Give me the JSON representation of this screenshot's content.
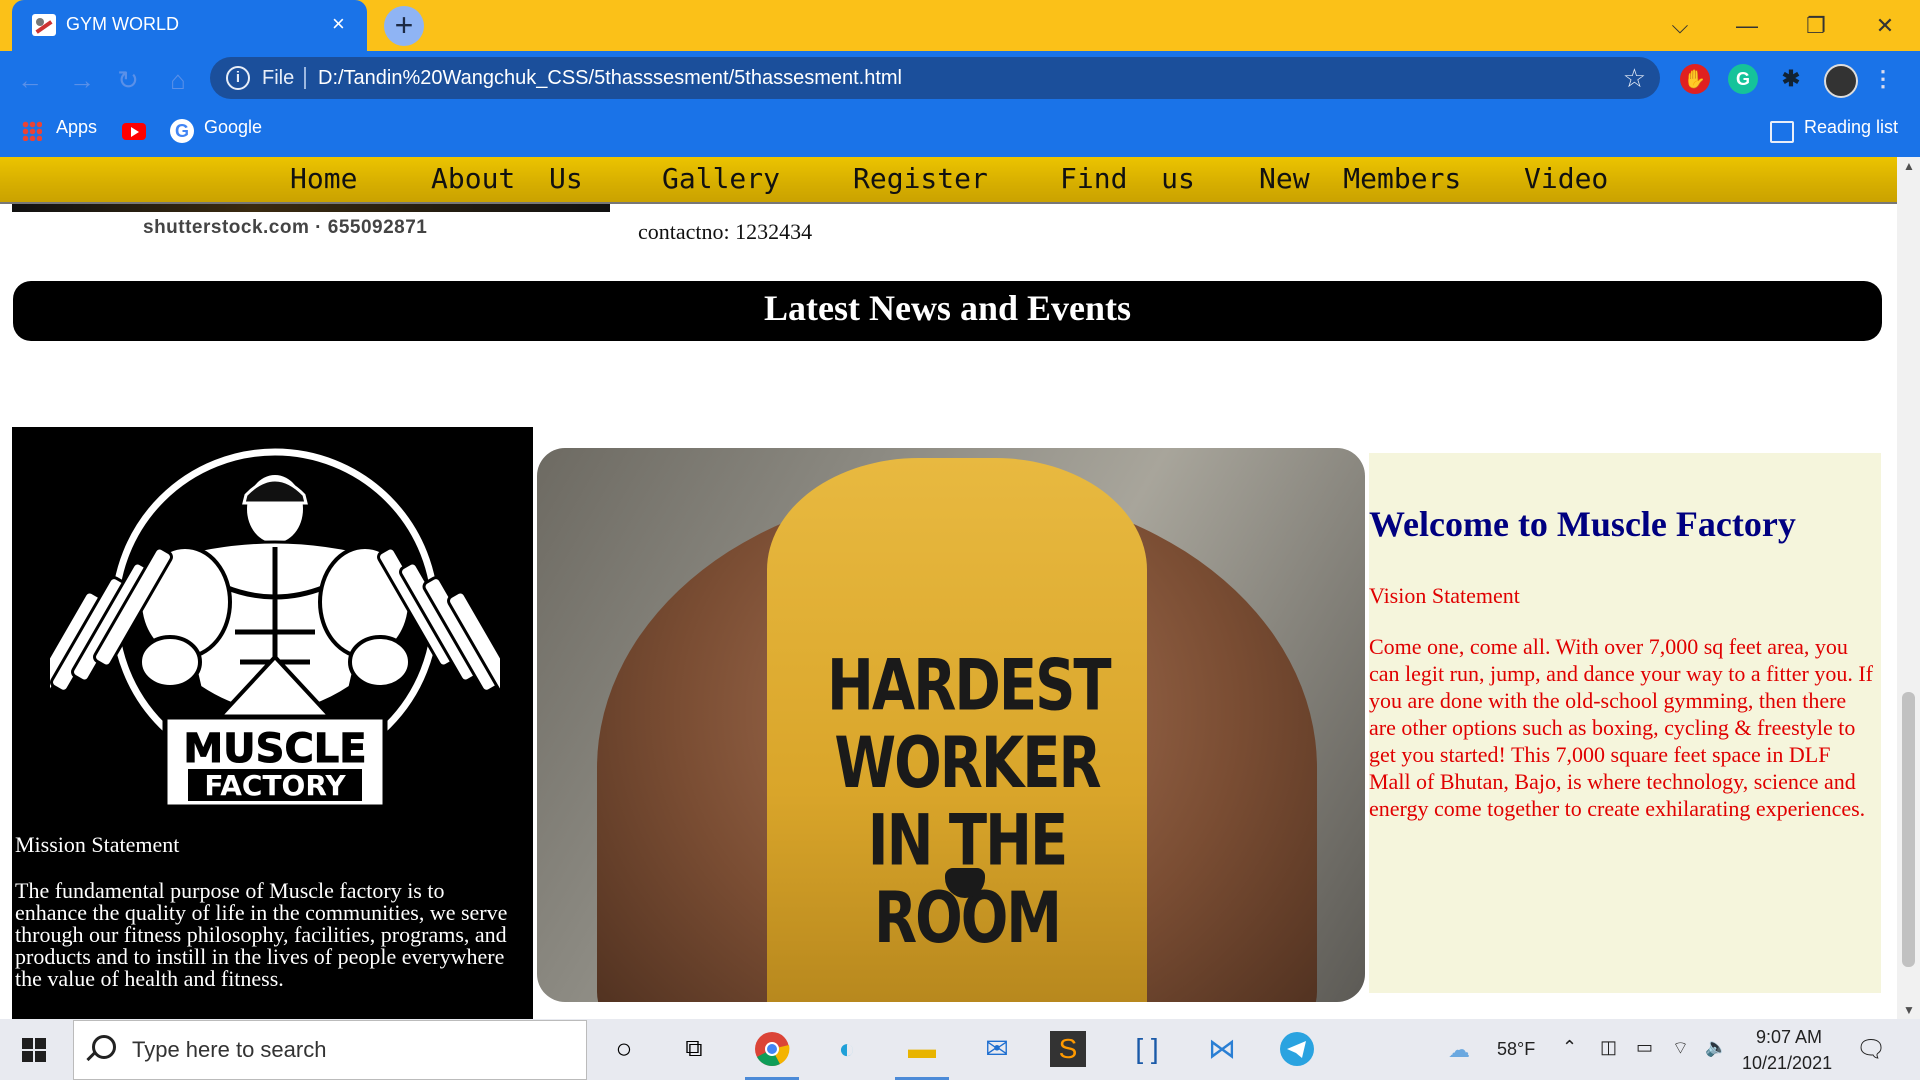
{
  "browser": {
    "tab_title": "GYM WORLD",
    "tab_close": "×",
    "new_tab": "+",
    "scheme": "File",
    "url": "D:/Tandin%20Wangchuk_CSS/5thasssesment/5thassesment.html",
    "bookmarks": [
      {
        "label": "Apps",
        "icon": "apps-grid-icon"
      },
      {
        "label": "Google",
        "icon": "google-icon"
      }
    ],
    "reading_list": "Reading list",
    "window_controls": [
      "⌵",
      "—",
      "❐",
      "✕"
    ]
  },
  "page": {
    "nav": [
      "Home",
      "About  Us",
      "Gallery",
      "Register",
      "Find  us",
      "New  Members",
      "Video"
    ],
    "watermark": "shutterstock.com · 655092871",
    "contact": "contactno: 1232434",
    "news_title": "Latest News and Events",
    "logo_line1": "MUSCLE",
    "logo_line2": "FACTORY",
    "mission_title": "Mission Statement",
    "mission_text": "The fundamental purpose of Muscle factory is to enhance the quality of life in the communities, we serve through our fitness philosophy, facilities, programs, and products and to instill in the lives of people everywhere the value of health and fitness.",
    "photo_shirt_text": "HARDEST WORKER IN THE ROOM",
    "welcome": "Welcome to Muscle Factory",
    "vision_title": "Vision Statement",
    "vision_text": "Come one, come all. With over 7,000 sq feet area, you can legit run, jump, and dance your way to a fitter you. If you are done with the old-school gymming, then there are other options such as boxing, cycling & freestyle to get you started! This 7,000 square feet space in DLF Mall of Bhutan, Bajo, is where technology, science and energy come together to create exhilarating experiences."
  },
  "taskbar": {
    "search_placeholder": "Type here to search",
    "weather": "58°F",
    "time": "9:07 AM",
    "date": "10/21/2021"
  },
  "colors": {
    "titlebar": "#fbc118",
    "chrome_blue": "#1a73e8",
    "navbar_gold": "#d6ae00",
    "welcome_navy": "#000080",
    "vision_red": "#e00000",
    "panel_beige": "#f5f5dc"
  }
}
